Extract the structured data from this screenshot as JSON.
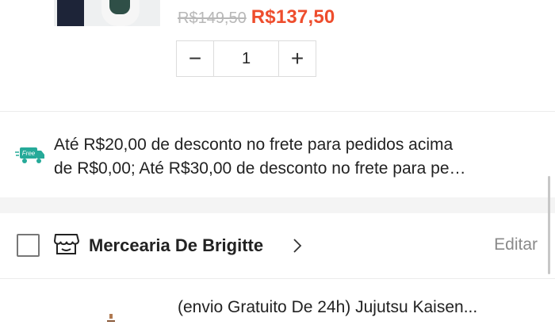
{
  "product": {
    "price_original": "R$149,50",
    "price_current": "R$137,50",
    "quantity": "1",
    "decrement_label": "−",
    "increment_label": "+"
  },
  "promo": {
    "badge": "Free",
    "line1": "Até R$20,00 de desconto no frete para pedidos acima",
    "line2": "de R$0,00; Até R$30,00 de desconto no frete para pe…",
    "icon": "free-shipping-truck-icon"
  },
  "shop": {
    "name": "Mercearia De Brigitte",
    "edit_label": "Editar",
    "icons": [
      "checkbox",
      "store-icon",
      "chevron-right-icon"
    ]
  },
  "next_product": {
    "title": "(envio Gratuito De 24h) Jujutsu Kaisen..."
  },
  "colors": {
    "accent": "#ee4d2d",
    "free_badge": "#26aa99",
    "muted": "#8a8a8a"
  }
}
